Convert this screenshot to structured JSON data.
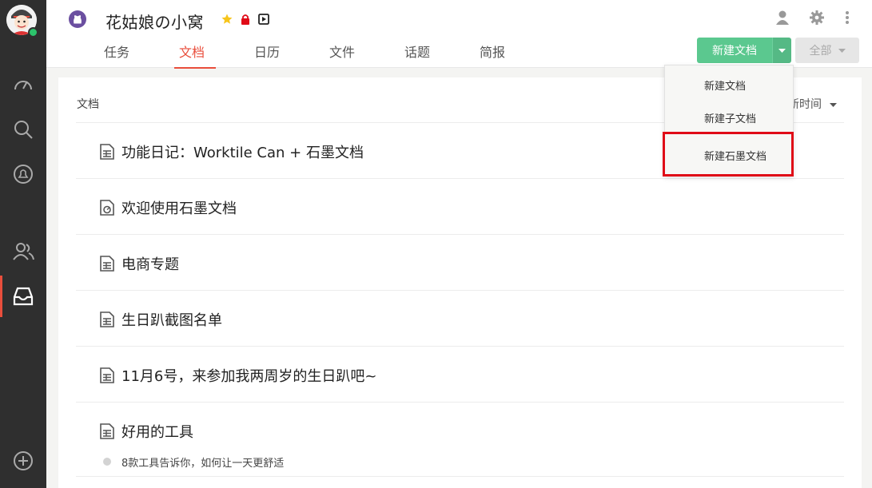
{
  "project": {
    "title": "花姑娘の小窝"
  },
  "tabs": [
    {
      "label": "任务"
    },
    {
      "label": "文档"
    },
    {
      "label": "日历"
    },
    {
      "label": "文件"
    },
    {
      "label": "话题"
    },
    {
      "label": "简报"
    }
  ],
  "toolbar": {
    "new_doc_label": "新建文档",
    "filter_label": "全部"
  },
  "panel": {
    "section_label": "文档",
    "sort_label": "新时间"
  },
  "documents": [
    {
      "title": "功能日记：Worktile Can + 石墨文档",
      "icon": "spreadsheet-icon"
    },
    {
      "title": "欢迎使用石墨文档",
      "icon": "shimo-doc-icon"
    },
    {
      "title": "电商专题",
      "icon": "spreadsheet-icon"
    },
    {
      "title": "生日趴截图名单",
      "icon": "spreadsheet-icon"
    },
    {
      "title": "11月6号，来参加我两周岁的生日趴吧~",
      "icon": "spreadsheet-icon"
    },
    {
      "title": "好用的工具",
      "icon": "spreadsheet-icon",
      "subitem": "8款工具告诉你，如何让一天更舒适"
    }
  ],
  "dropdown": {
    "items": [
      {
        "label": "新建文档"
      },
      {
        "label": "新建子文档"
      },
      {
        "label": "新建石墨文档"
      }
    ]
  },
  "colors": {
    "accent": "#e94e3c",
    "primary_button": "#5bc88f",
    "sidebar": "#2f2f2f",
    "highlight_box": "#e00b17"
  }
}
